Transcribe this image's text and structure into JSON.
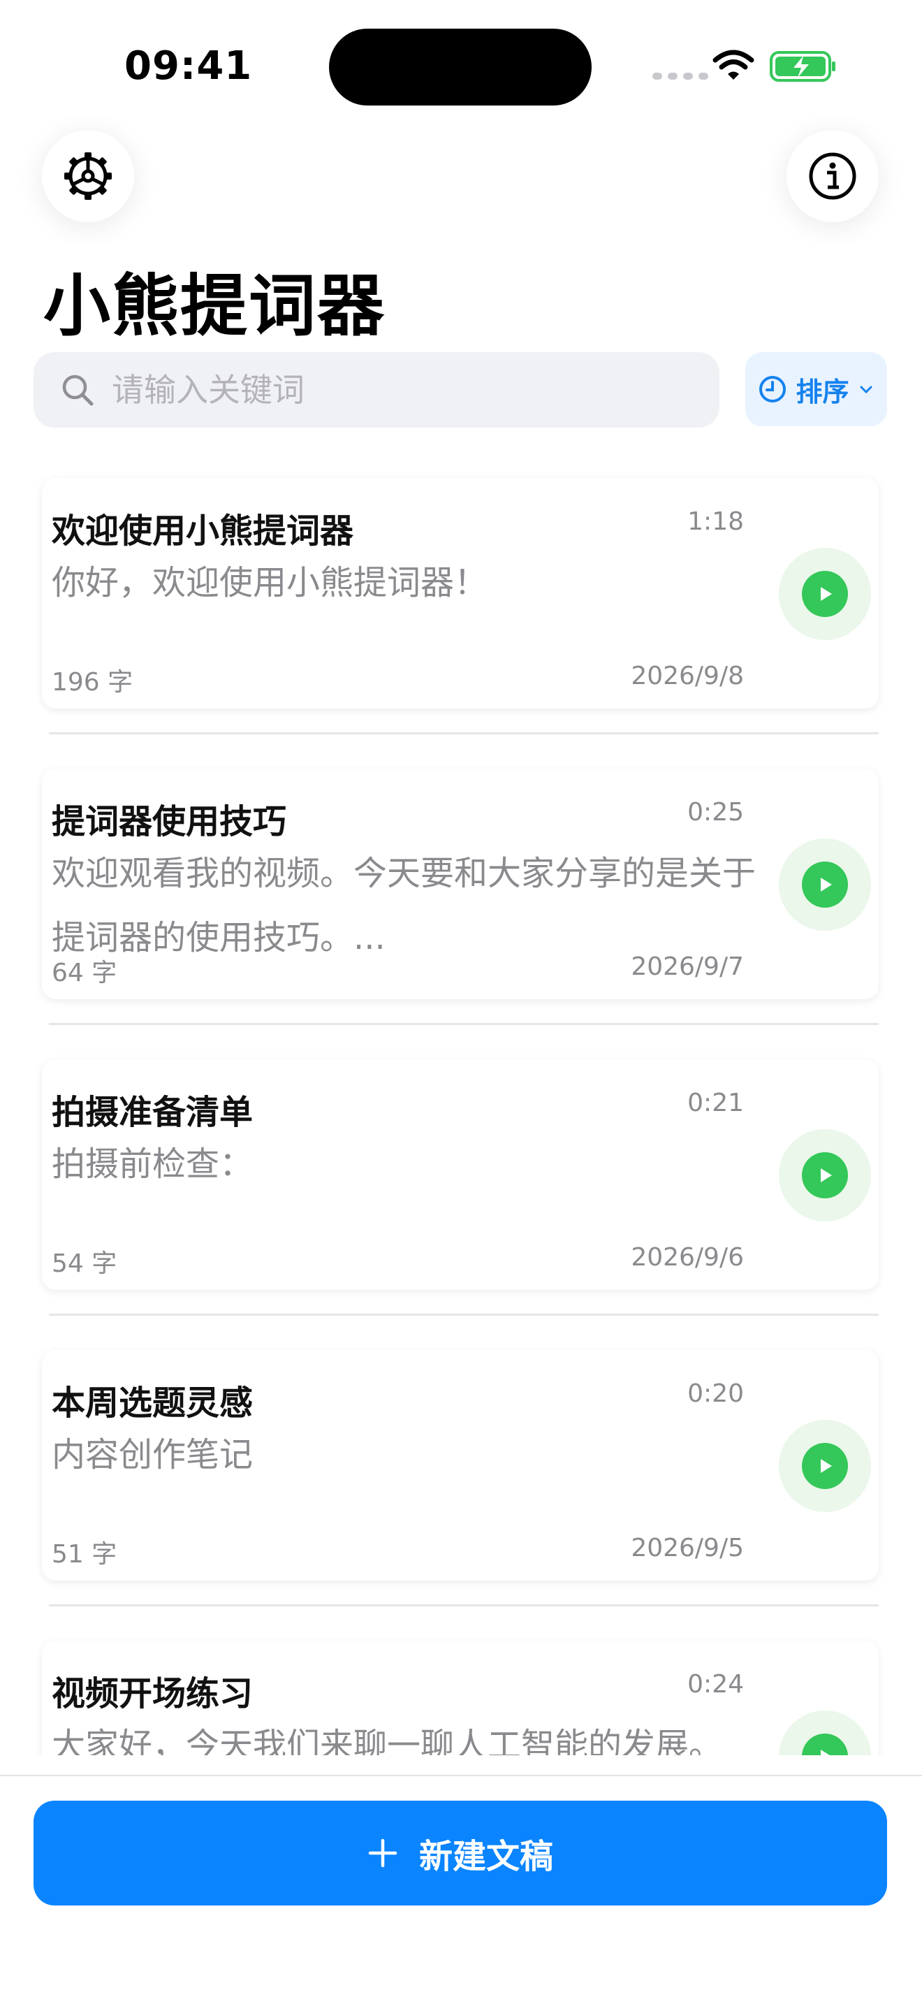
{
  "status_bar": {
    "time": "09:41"
  },
  "app": {
    "title": "小熊提词器"
  },
  "search": {
    "placeholder": "请输入关键词",
    "value": ""
  },
  "sort": {
    "label": "排序"
  },
  "scripts": [
    {
      "title": "欢迎使用小熊提词器",
      "duration": "1:18",
      "preview": "你好，欢迎使用小熊提词器！",
      "word_count": "196 字",
      "date": "2026/9/8"
    },
    {
      "title": "提词器使用技巧",
      "duration": "0:25",
      "preview": "欢迎观看我的视频。今天要和大家分享的是关于提词器的使用技巧。...",
      "word_count": "64 字",
      "date": "2026/9/7"
    },
    {
      "title": "拍摄准备清单",
      "duration": "0:21",
      "preview": "拍摄前检查：",
      "word_count": "54 字",
      "date": "2026/9/6"
    },
    {
      "title": "本周选题灵感",
      "duration": "0:20",
      "preview": "内容创作笔记",
      "word_count": "51 字",
      "date": "2026/9/5"
    },
    {
      "title": "视频开场练习",
      "duration": "0:24",
      "preview": "大家好，今天我们来聊一聊人工智能的发展。",
      "word_count": "",
      "date": ""
    }
  ],
  "actions": {
    "new_script_label": "新建文稿"
  },
  "colors": {
    "accent": "#0a84ff",
    "play": "#34c759",
    "sort_text": "#1582ee"
  }
}
